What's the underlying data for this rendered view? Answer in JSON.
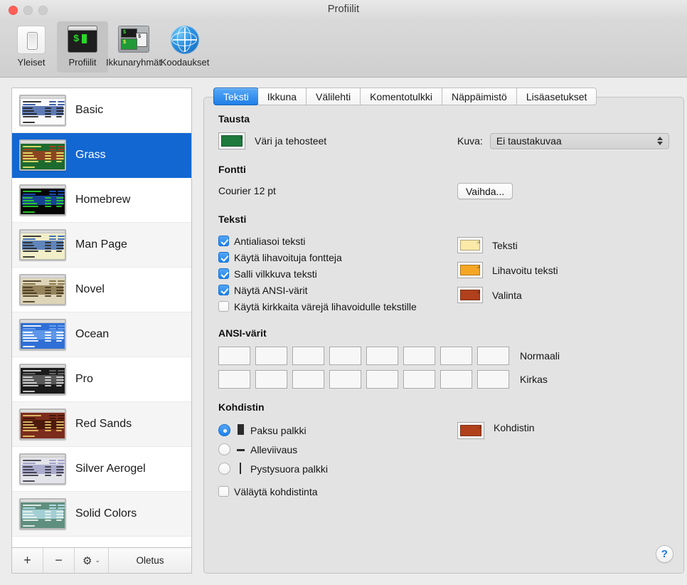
{
  "window": {
    "title": "Profiilit",
    "traffic_lights": [
      "close",
      "minimize",
      "zoom"
    ]
  },
  "toolbar": {
    "items": [
      {
        "label": "Yleiset",
        "icon": "toggle-switch-icon",
        "selected": false
      },
      {
        "label": "Profiilit",
        "icon": "terminal-window-icon",
        "selected": true
      },
      {
        "label": "Ikkunaryhmät",
        "icon": "window-groups-icon",
        "selected": false
      },
      {
        "label": "Koodaukset",
        "icon": "globe-icon",
        "selected": false
      }
    ]
  },
  "sidebar": {
    "profiles": [
      {
        "name": "Basic",
        "bg": "#fbfbfb",
        "fg": "#222222",
        "accent": "#2a4f9e",
        "selected": false
      },
      {
        "name": "Grass",
        "bg": "#1d6a2f",
        "fg": "#e8e36a",
        "accent": "#b23a1e",
        "selected": true
      },
      {
        "name": "Homebrew",
        "bg": "#060606",
        "fg": "#2ad52a",
        "accent": "#1d57c4",
        "selected": false
      },
      {
        "name": "Man Page",
        "bg": "#f2eec8",
        "fg": "#2b2b2b",
        "accent": "#2f62b8",
        "selected": false
      },
      {
        "name": "Novel",
        "bg": "#ded5b8",
        "fg": "#4a3b22",
        "accent": "#7d6a3e",
        "selected": false
      },
      {
        "name": "Ocean",
        "bg": "#2f6fd6",
        "fg": "#ffffff",
        "accent": "#6fa4ef",
        "selected": false
      },
      {
        "name": "Pro",
        "bg": "#1b1b1b",
        "fg": "#d8d8d8",
        "accent": "#6e6e6e",
        "selected": false
      },
      {
        "name": "Red Sands",
        "bg": "#7c2c1c",
        "fg": "#e6c56a",
        "accent": "#3d1408",
        "selected": false
      },
      {
        "name": "Silver Aerogel",
        "bg": "#e3e3ea",
        "fg": "#3a3a46",
        "accent": "#9a9ac4",
        "selected": false
      },
      {
        "name": "Solid Colors",
        "bg": "#5f8f7e",
        "fg": "#e9f2ec",
        "accent": "#b9e4f2",
        "selected": false
      }
    ],
    "footer": {
      "add_label": "+",
      "remove_label": "−",
      "gear_label": "⚙",
      "gear_chevron": "⌄",
      "default_label": "Oletus"
    }
  },
  "tabs": [
    {
      "label": "Teksti",
      "active": true
    },
    {
      "label": "Ikkuna",
      "active": false
    },
    {
      "label": "Välilehti",
      "active": false
    },
    {
      "label": "Komentotulkki",
      "active": false
    },
    {
      "label": "Näppäimistö",
      "active": false
    },
    {
      "label": "Lisäasetukset",
      "active": false
    }
  ],
  "panel": {
    "background_section": {
      "title": "Tausta",
      "color_label": "Väri ja tehosteet",
      "color_value": "#1f7a3d",
      "image_label": "Kuva:",
      "image_value": "Ei taustakuvaa"
    },
    "font_section": {
      "title": "Fontti",
      "font_value": "Courier 12 pt",
      "change_button": "Vaihda..."
    },
    "text_section": {
      "title": "Teksti",
      "checkboxes": [
        {
          "label": "Antialiasoi teksti",
          "checked": true
        },
        {
          "label": "Käytä lihavoituja fontteja",
          "checked": true
        },
        {
          "label": "Salli vilkkuva teksti",
          "checked": true
        },
        {
          "label": "Näytä ANSI-värit",
          "checked": true
        },
        {
          "label": "Käytä kirkkaita värejä lihavoidulle tekstille",
          "checked": false
        }
      ],
      "color_wells": [
        {
          "label": "Teksti",
          "color": "#fbe9a8"
        },
        {
          "label": "Lihavoitu teksti",
          "color": "#f5a623"
        },
        {
          "label": "Valinta",
          "color": "#b1401c"
        }
      ]
    },
    "ansi_section": {
      "title": "ANSI-värit",
      "rows": [
        {
          "label": "Normaali",
          "colors": [
            "#000000",
            "#990000",
            "#0f9a10",
            "#9a9100",
            "#1a119c",
            "#b31cb5",
            "#0f9aa8",
            "#bfbfbf"
          ]
        },
        {
          "label": "Kirkas",
          "colors": [
            "#5e5e5e",
            "#f21118",
            "#19e319",
            "#eedd00",
            "#1f1ff5",
            "#ef1cef",
            "#1ae6ea",
            "#ececec"
          ]
        }
      ]
    },
    "cursor_section": {
      "title": "Kohdistin",
      "radios": [
        {
          "label": "Paksu palkki",
          "glyph": "block",
          "selected": true
        },
        {
          "label": "Alleviivaus",
          "glyph": "underline",
          "selected": false
        },
        {
          "label": "Pystysuora palkki",
          "glyph": "vertical",
          "selected": false
        }
      ],
      "blink_checkbox": {
        "label": "Väläytä kohdistinta",
        "checked": false
      },
      "cursor_well": {
        "label": "Kohdistin",
        "color": "#b1401c"
      }
    },
    "help_button": "?"
  }
}
